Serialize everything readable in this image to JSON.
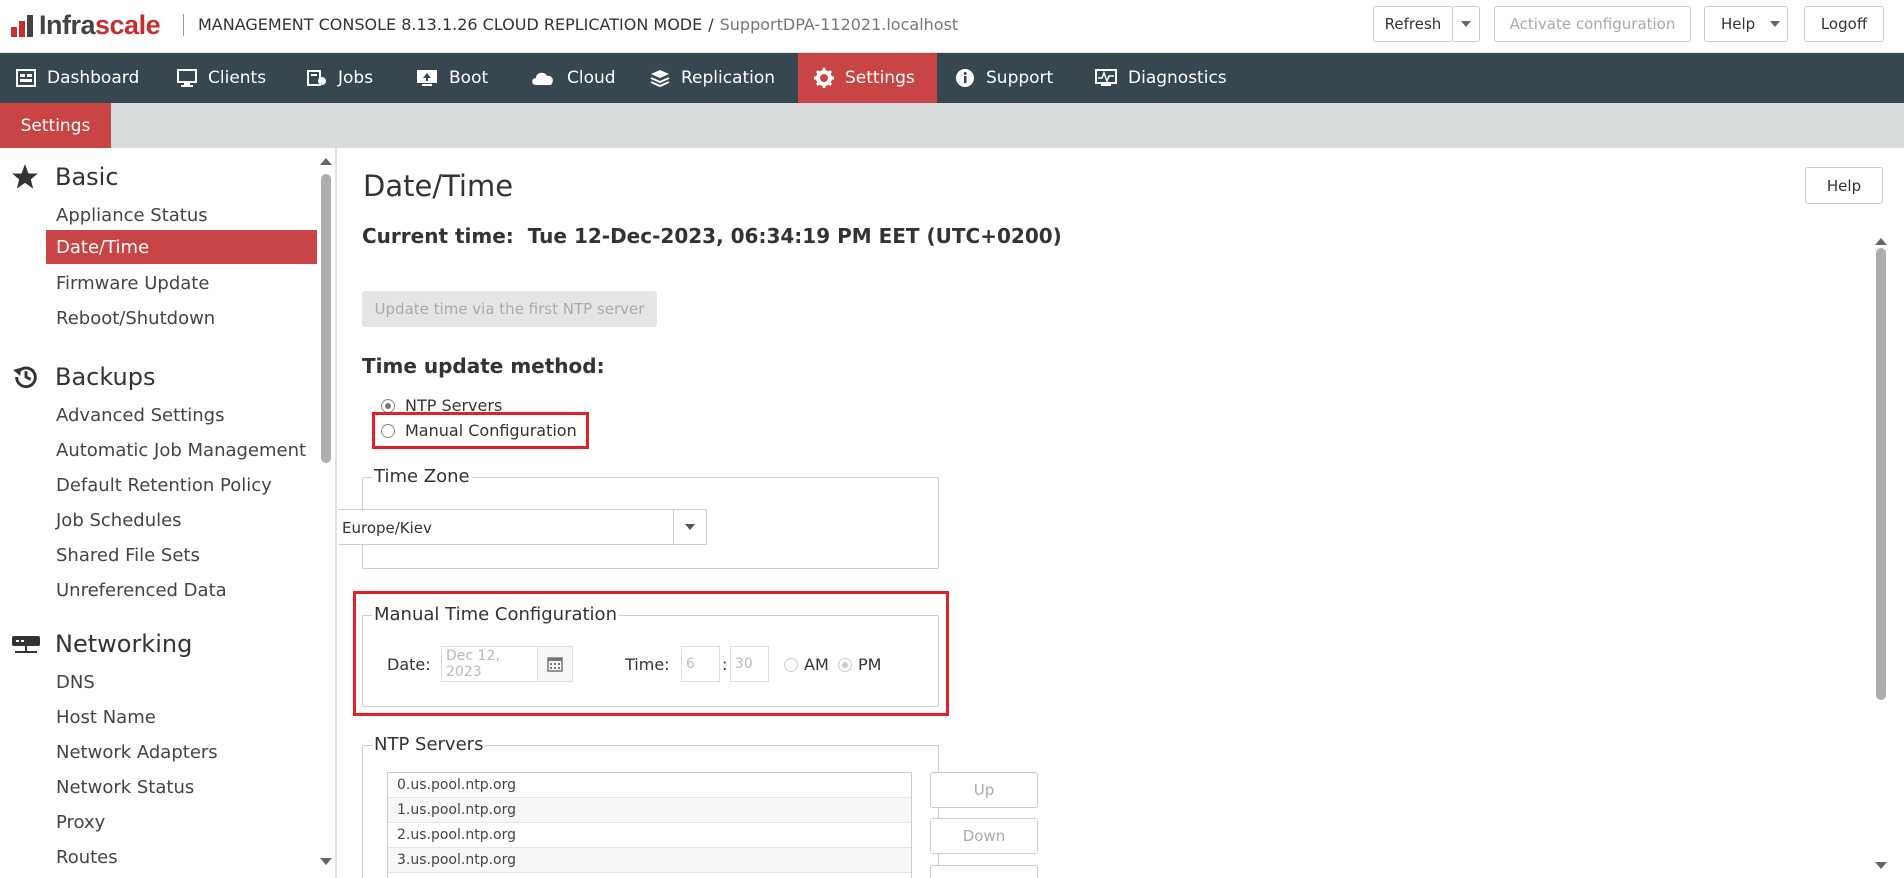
{
  "header": {
    "logo_prefix": "Infra",
    "logo_suffix": "scale",
    "console_title": "MANAGEMENT CONSOLE 8.13.1.26 CLOUD REPLICATION MODE",
    "separator": "/",
    "host": "SupportDPA-112021.localhost",
    "refresh_label": "Refresh",
    "activate_label": "Activate configuration",
    "help_label": "Help",
    "logoff_label": "Logoff"
  },
  "nav": {
    "items": [
      {
        "label": "Dashboard",
        "icon": "dashboard-icon"
      },
      {
        "label": "Clients",
        "icon": "monitor-icon"
      },
      {
        "label": "Jobs",
        "icon": "jobs-icon"
      },
      {
        "label": "Boot",
        "icon": "boot-icon"
      },
      {
        "label": "Cloud",
        "icon": "cloud-icon"
      },
      {
        "label": "Replication",
        "icon": "layers-icon"
      },
      {
        "label": "Settings",
        "icon": "gear-icon",
        "active": true
      },
      {
        "label": "Support",
        "icon": "info-icon"
      },
      {
        "label": "Diagnostics",
        "icon": "diagnostics-icon"
      }
    ]
  },
  "subnav": {
    "tab_label": "Settings"
  },
  "sidebar": {
    "sections": [
      {
        "title": "Basic",
        "icon": "star-icon",
        "items": [
          "Appliance Status",
          "Date/Time",
          "Firmware Update",
          "Reboot/Shutdown"
        ]
      },
      {
        "title": "Backups",
        "icon": "history-icon",
        "items": [
          "Advanced Settings",
          "Automatic Job Management",
          "Default Retention Policy",
          "Job Schedules",
          "Shared File Sets",
          "Unreferenced Data"
        ]
      },
      {
        "title": "Networking",
        "icon": "network-icon",
        "items": [
          "DNS",
          "Host Name",
          "Network Adapters",
          "Network Status",
          "Proxy",
          "Routes"
        ]
      }
    ],
    "active_item": "Date/Time"
  },
  "main": {
    "title": "Date/Time",
    "help_label": "Help",
    "current_time_label": "Current time:",
    "current_time_value": "Tue 12-Dec-2023, 06:34:19 PM EET (UTC+0200)",
    "ntp_update_button": "Update time via the first NTP server",
    "method_label": "Time update method:",
    "method_options": [
      {
        "label": "NTP Servers",
        "checked": true
      },
      {
        "label": "Manual Configuration",
        "checked": false
      }
    ],
    "timezone": {
      "legend": "Time Zone",
      "value": "Europe/Kiev"
    },
    "manual": {
      "legend": "Manual Time Configuration",
      "date_label": "Date:",
      "date_value": "Dec 12, 2023",
      "time_label": "Time:",
      "hour": "6",
      "colon": ":",
      "minute": "30",
      "am_label": "AM",
      "pm_label": "PM",
      "pm_checked": true
    },
    "ntp": {
      "legend": "NTP Servers",
      "servers": [
        "0.us.pool.ntp.org",
        "1.us.pool.ntp.org",
        "2.us.pool.ntp.org",
        "3.us.pool.ntp.org"
      ],
      "up_label": "Up",
      "down_label": "Down"
    }
  },
  "colors": {
    "accent": "#c94444",
    "navbar": "#37474f",
    "highlight": "#e32028"
  }
}
